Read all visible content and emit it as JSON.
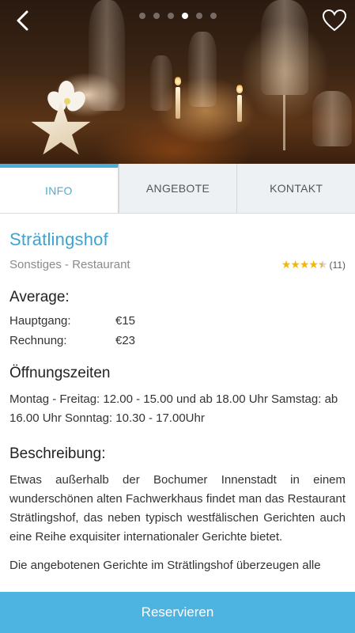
{
  "hero": {
    "slide_count": 6,
    "active_slide": 4
  },
  "tabs": [
    {
      "label": "INFO",
      "active": true
    },
    {
      "label": "ANGEBOTE",
      "active": false
    },
    {
      "label": "KONTAKT",
      "active": false
    }
  ],
  "restaurant": {
    "name": "Strätlingshof",
    "category": "Sonstiges - Restaurant",
    "rating_stars": 4.5,
    "review_count": "(11)"
  },
  "average": {
    "heading": "Average:",
    "rows": [
      {
        "label": "Hauptgang:",
        "value": "€15"
      },
      {
        "label": "Rechnung:",
        "value": "€23"
      }
    ]
  },
  "hours": {
    "heading": "Öffnungszeiten",
    "text": "Montag - Freitag: 12.00 - 15.00 und ab 18.00 Uhr Samstag: ab 16.00 Uhr Sonntag: 10.30 - 17.00Uhr"
  },
  "description": {
    "heading": "Beschreibung:",
    "paragraphs": [
      "Etwas außerhalb der Bochumer Innenstadt in einem wunderschönen alten Fachwerkhaus findet man das Restaurant Strätlingshof, das neben typisch westfälischen Gerichten auch eine Reihe exquisiter internationaler Gerichte bietet.",
      "Die angebotenen Gerichte im Strätlingshof überzeugen alle"
    ]
  },
  "actions": {
    "reserve_label": "Reservieren"
  },
  "colors": {
    "accent": "#4aaed8",
    "button": "#4db4e2",
    "star": "#f2b705"
  },
  "icons": {
    "back": "chevron-left-icon",
    "favorite": "heart-outline-icon",
    "star": "star-icon"
  }
}
